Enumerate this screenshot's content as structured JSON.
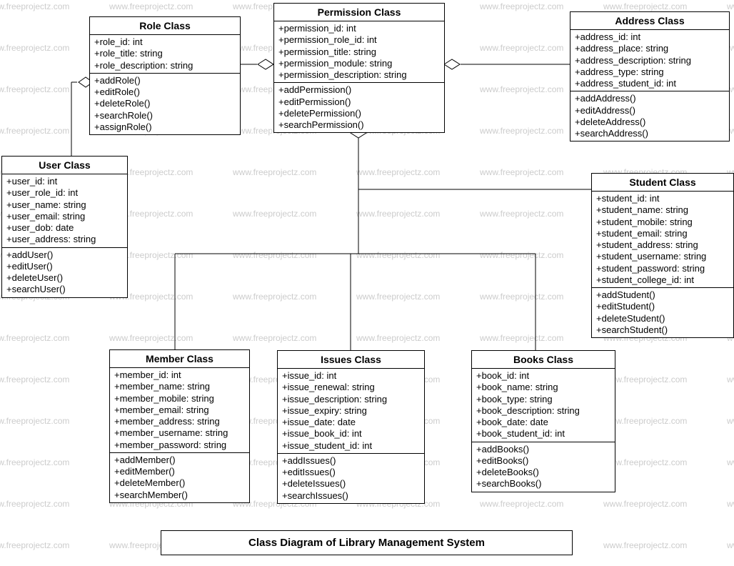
{
  "diagram_title": "Class Diagram of Library Management System",
  "watermark_text": "www.freeprojectz.com",
  "classes": {
    "role": {
      "name": "Role Class",
      "attrs": [
        "+role_id: int",
        "+role_title: string",
        "+role_description: string"
      ],
      "methods": [
        "+addRole()",
        "+editRole()",
        "+deleteRole()",
        "+searchRole()",
        "+assignRole()"
      ]
    },
    "permission": {
      "name": "Permission Class",
      "attrs": [
        "+permission_id: int",
        "+permission_role_id: int",
        "+permission_title: string",
        "+permission_module: string",
        "+permission_description: string"
      ],
      "methods": [
        "+addPermission()",
        "+editPermission()",
        "+deletePermission()",
        "+searchPermission()"
      ]
    },
    "address": {
      "name": "Address Class",
      "attrs": [
        "+address_id: int",
        "+address_place: string",
        "+address_description: string",
        "+address_type: string",
        "+address_student_id: int"
      ],
      "methods": [
        "+addAddress()",
        "+editAddress()",
        "+deleteAddress()",
        "+searchAddress()"
      ]
    },
    "user": {
      "name": "User Class",
      "attrs": [
        "+user_id: int",
        "+user_role_id: int",
        "+user_name: string",
        "+user_email: string",
        "+user_dob: date",
        "+user_address: string"
      ],
      "methods": [
        "+addUser()",
        "+editUser()",
        "+deleteUser()",
        "+searchUser()"
      ]
    },
    "student": {
      "name": "Student Class",
      "attrs": [
        "+student_id: int",
        "+student_name: string",
        "+student_mobile: string",
        "+student_email: string",
        "+student_address: string",
        "+student_username: string",
        "+student_password: string",
        "+student_college_id: int"
      ],
      "methods": [
        "+addStudent()",
        "+editStudent()",
        "+deleteStudent()",
        "+searchStudent()"
      ]
    },
    "member": {
      "name": "Member Class",
      "attrs": [
        "+member_id: int",
        "+member_name: string",
        "+member_mobile: string",
        "+member_email: string",
        "+member_address: string",
        "+member_username: string",
        "+member_password: string"
      ],
      "methods": [
        "+addMember()",
        "+editMember()",
        "+deleteMember()",
        "+searchMember()"
      ]
    },
    "issues": {
      "name": "Issues Class",
      "attrs": [
        "+issue_id: int",
        "+issue_renewal: string",
        "+issue_description: string",
        "+issue_expiry: string",
        "+issue_date: date",
        "+issue_book_id: int",
        "+issue_student_id: int"
      ],
      "methods": [
        "+addIssues()",
        "+editIssues()",
        "+deleteIssues()",
        "+searchIssues()"
      ]
    },
    "books": {
      "name": "Books Class",
      "attrs": [
        "+book_id: int",
        "+book_name: string",
        "+book_type: string",
        "+book_description: string",
        "+book_date: date",
        "+book_student_id: int"
      ],
      "methods": [
        "+addBooks()",
        "+editBooks()",
        "+deleteBooks()",
        "+searchBooks()"
      ]
    }
  },
  "relationships": [
    {
      "from": "User",
      "to": "Role",
      "type": "aggregation"
    },
    {
      "from": "Role",
      "to": "Permission",
      "type": "aggregation"
    },
    {
      "from": "Permission",
      "to": "Address",
      "type": "aggregation"
    },
    {
      "from": "Permission",
      "to": "Books",
      "type": "aggregation"
    },
    {
      "from": "Permission",
      "to": "Member",
      "type": "line"
    },
    {
      "from": "Permission",
      "to": "Issues",
      "type": "line"
    },
    {
      "from": "Permission",
      "to": "Student",
      "type": "line"
    }
  ]
}
